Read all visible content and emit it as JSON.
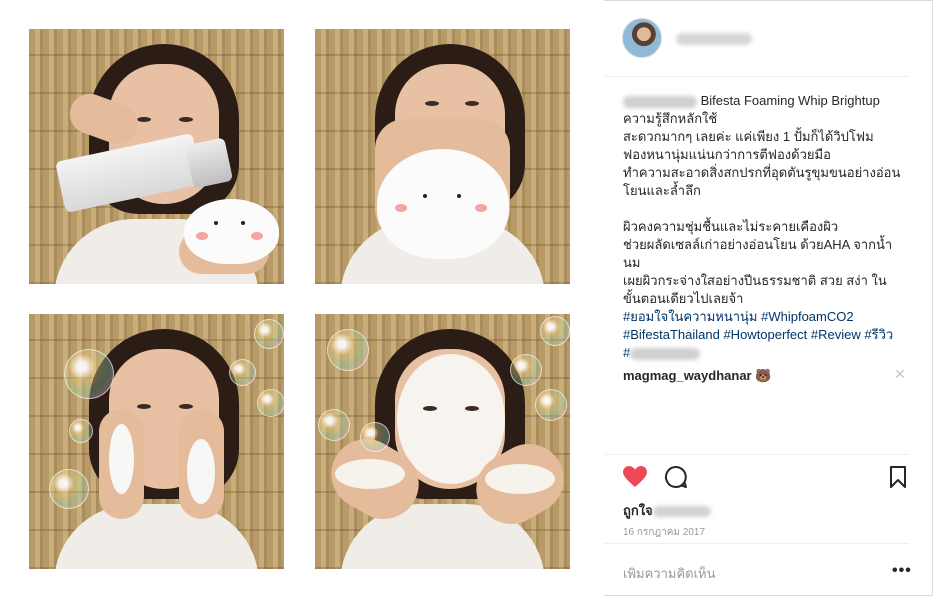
{
  "post": {
    "caption_line1_tail": " Bifesta Foaming Whip Brightup",
    "caption_body": "ความรู้สึกหลักใช้\nสะดวกมากๆ เลยค่ะ แค่เพียง 1 ปั้มก็ได้วิปโฟม\nฟองหนานุ่มแน่นกว่าการตีฟองด้วยมือ\nทำความสะอาดสิ่งสกปรกที่อุดตันรูขุมขนอย่างอ่อน\nโยนและล้ำลึก\n\nผิวคงความชุ่มชื้นและไม่ระคายเคืองผิว\nช่วยผลัดเซลล์เก่าอย่างอ่อนโยน ด้วยAHA จากน้ำ\nนม\nเผยผิวกระจ่างใสอย่างปีนธรรมชาติ สวย สง่า ใน\nขั้นตอนเดียวไปเลยจ้า",
    "hashtags_line1": "#ยอมใจในความหนานุ่ม #WhipfoamCO2",
    "hashtags_line2": "#BifestaThailand #Howtoperfect #Review #รีวิว",
    "hashtags_line3_prefix": "#"
  },
  "comment": {
    "username": "magmag_waydhanar",
    "emoji": "🐻",
    "close_icon": "close-icon"
  },
  "likes": {
    "prefix": "ถูกใจ"
  },
  "date": "16 กรกฎาคม 2017",
  "add_comment": {
    "placeholder": "เพิ่มความคิดเห็น",
    "more_label": "•••"
  },
  "colors": {
    "like_red": "#ed4956",
    "hashtag_blue": "#003569",
    "muted_gray": "#999999",
    "divider": "#efefef"
  },
  "icons": [
    "heart-icon",
    "comment-icon",
    "bookmark-icon",
    "more-icon"
  ]
}
